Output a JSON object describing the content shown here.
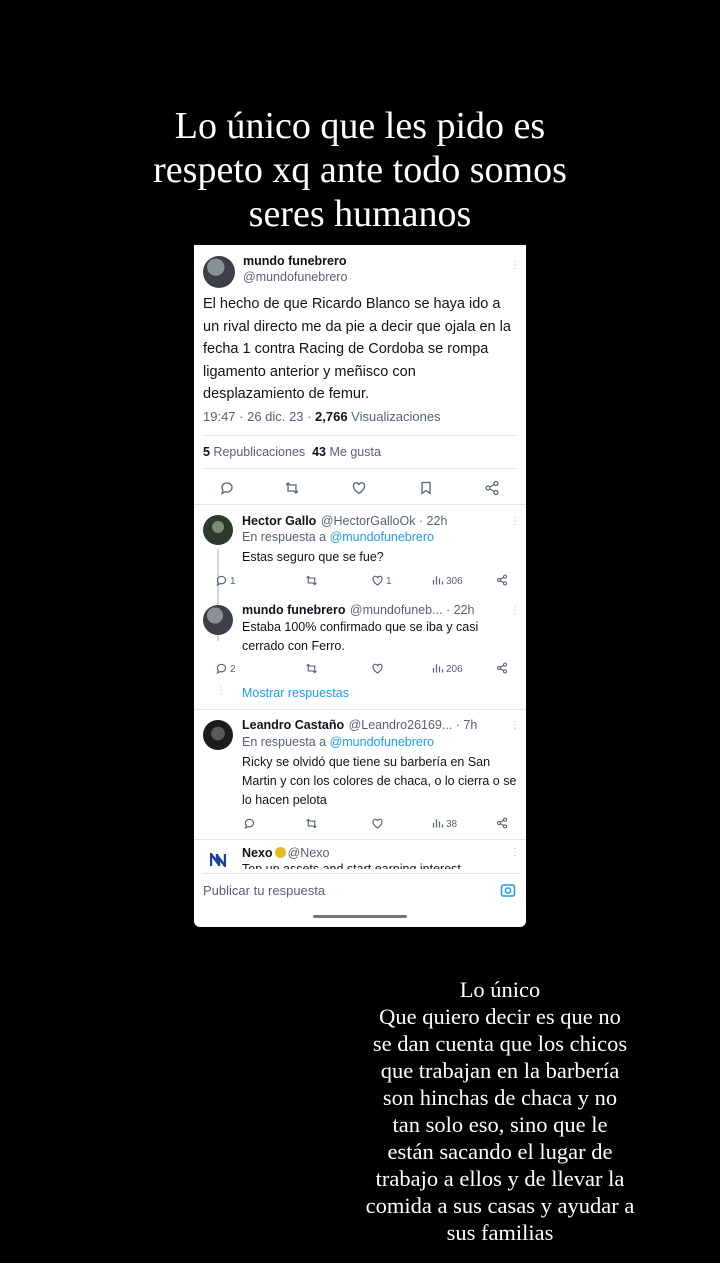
{
  "captions": {
    "top": [
      "Lo único que les pido es",
      "respeto xq ante todo somos",
      "seres humanos"
    ],
    "bottom": [
      "Lo único",
      "Que quiero decir es que no",
      "se dan cuenta que los chicos",
      "que trabajan en la barbería",
      "son hinchas de chaca y no",
      "tan solo eso, sino que le",
      "están sacando el lugar de",
      "trabajo a ellos y de llevar la",
      "comida a sus casas y ayudar a",
      "sus familias"
    ]
  },
  "main_tweet": {
    "name": "mundo funebrero",
    "handle": "@mundofunebrero",
    "text": "El hecho de que Ricardo Blanco se haya ido a un rival directo me da pie a decir que ojala en la fecha 1 contra Racing de Cordoba se rompa ligamento anterior y meñisco con desplazamiento de femur.",
    "meta": "19:47 · 26 dic. 23 · ",
    "views": "2,766",
    "views_label": " Visualizaciones",
    "reposts": "5",
    "reposts_label": " Republicaciones",
    "likes": "43",
    "likes_label": " Me gusta"
  },
  "replies": [
    {
      "name": "Hector Gallo",
      "handle": "@HectorGalloOk · 22h",
      "reply_to_prefix": "En respuesta a ",
      "reply_to": "@mundofunebrero",
      "text": "Estas seguro que se fue?",
      "replies_count": "1",
      "likes_count": "1",
      "views": "306"
    },
    {
      "name": "mundo funebrero",
      "handle": "@mundofuneb... · 22h",
      "text": "Estaba 100% confirmado que se iba y casi cerrado con Ferro.",
      "replies_count": "2",
      "views": "206"
    },
    {
      "name": "Leandro Castaño",
      "handle": "@Leandro26169... · 7h",
      "reply_to_prefix": "En respuesta a ",
      "reply_to": "@mundofunebrero",
      "text": "Ricky se olvidó que tiene su barbería en San Martin y con los colores de chaca, o lo cierra o se lo hacen pelota",
      "views": "38"
    }
  ],
  "show_replies": "Mostrar respuestas",
  "ad": {
    "name": "Nexo",
    "handle": "@Nexo",
    "text": "Top up assets and start earning interest"
  },
  "reply_input": {
    "placeholder": "Publicar tu respuesta"
  },
  "colors": {
    "background": "#000000",
    "link": "#1d9bf0",
    "muted": "#536471"
  },
  "icons": [
    "reply-icon",
    "repost-icon",
    "like-icon",
    "bookmark-icon",
    "share-icon",
    "views-icon",
    "camera-icon",
    "more-icon",
    "verified-icon"
  ]
}
